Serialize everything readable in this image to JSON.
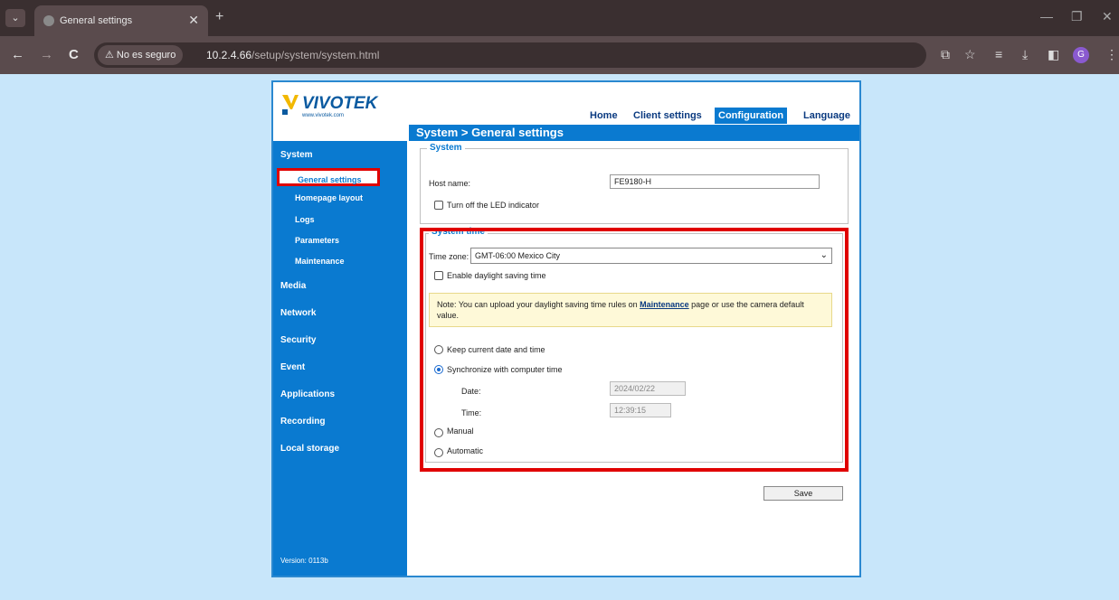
{
  "browser": {
    "tab_title": "General settings",
    "tab_close": "✕",
    "new_tab": "+",
    "back": "←",
    "forward": "→",
    "reload": "C",
    "insecure_label": "⚠ No es seguro",
    "url_host": "10.2.4.66",
    "url_path": "/setup/system/system.html",
    "profile_initial": "G"
  },
  "header": {
    "logo_text": "VIVOTEK",
    "logo_sub": "www.vivotek.com",
    "nav": [
      {
        "label": "Home"
      },
      {
        "label": "Client settings"
      },
      {
        "label": "Configuration"
      },
      {
        "label": "Language"
      }
    ],
    "breadcrumb": "System  > General settings"
  },
  "sidebar": {
    "section": "System",
    "subitems": [
      {
        "label": "General settings"
      },
      {
        "label": "Homepage layout"
      },
      {
        "label": "Logs"
      },
      {
        "label": "Parameters"
      },
      {
        "label": "Maintenance"
      }
    ],
    "items": [
      {
        "label": "Media"
      },
      {
        "label": "Network"
      },
      {
        "label": "Security"
      },
      {
        "label": "Event"
      },
      {
        "label": "Applications"
      },
      {
        "label": "Recording"
      },
      {
        "label": "Local storage"
      }
    ],
    "version": "Version: 0113b"
  },
  "system": {
    "legend": "System",
    "host_name_label": "Host name:",
    "host_name_value": "FE9180-H",
    "led_label": "Turn off the LED indicator"
  },
  "system_time": {
    "legend": "System time",
    "timezone_label": "Time zone:",
    "timezone_value": "GMT-06:00 Mexico City",
    "daylight_label": "Enable daylight saving time",
    "note_prefix": "Note: You can upload your daylight saving time rules on ",
    "note_link": "Maintenance",
    "note_suffix": " page or use the camera default value.",
    "opt_keep": "Keep current date and time",
    "opt_sync": "Synchronize with computer time",
    "date_label": "Date:",
    "date_value": "2024/02/22",
    "time_label": "Time:",
    "time_value": "12:39:15",
    "opt_manual": "Manual",
    "opt_auto": "Automatic"
  },
  "save_label": "Save"
}
